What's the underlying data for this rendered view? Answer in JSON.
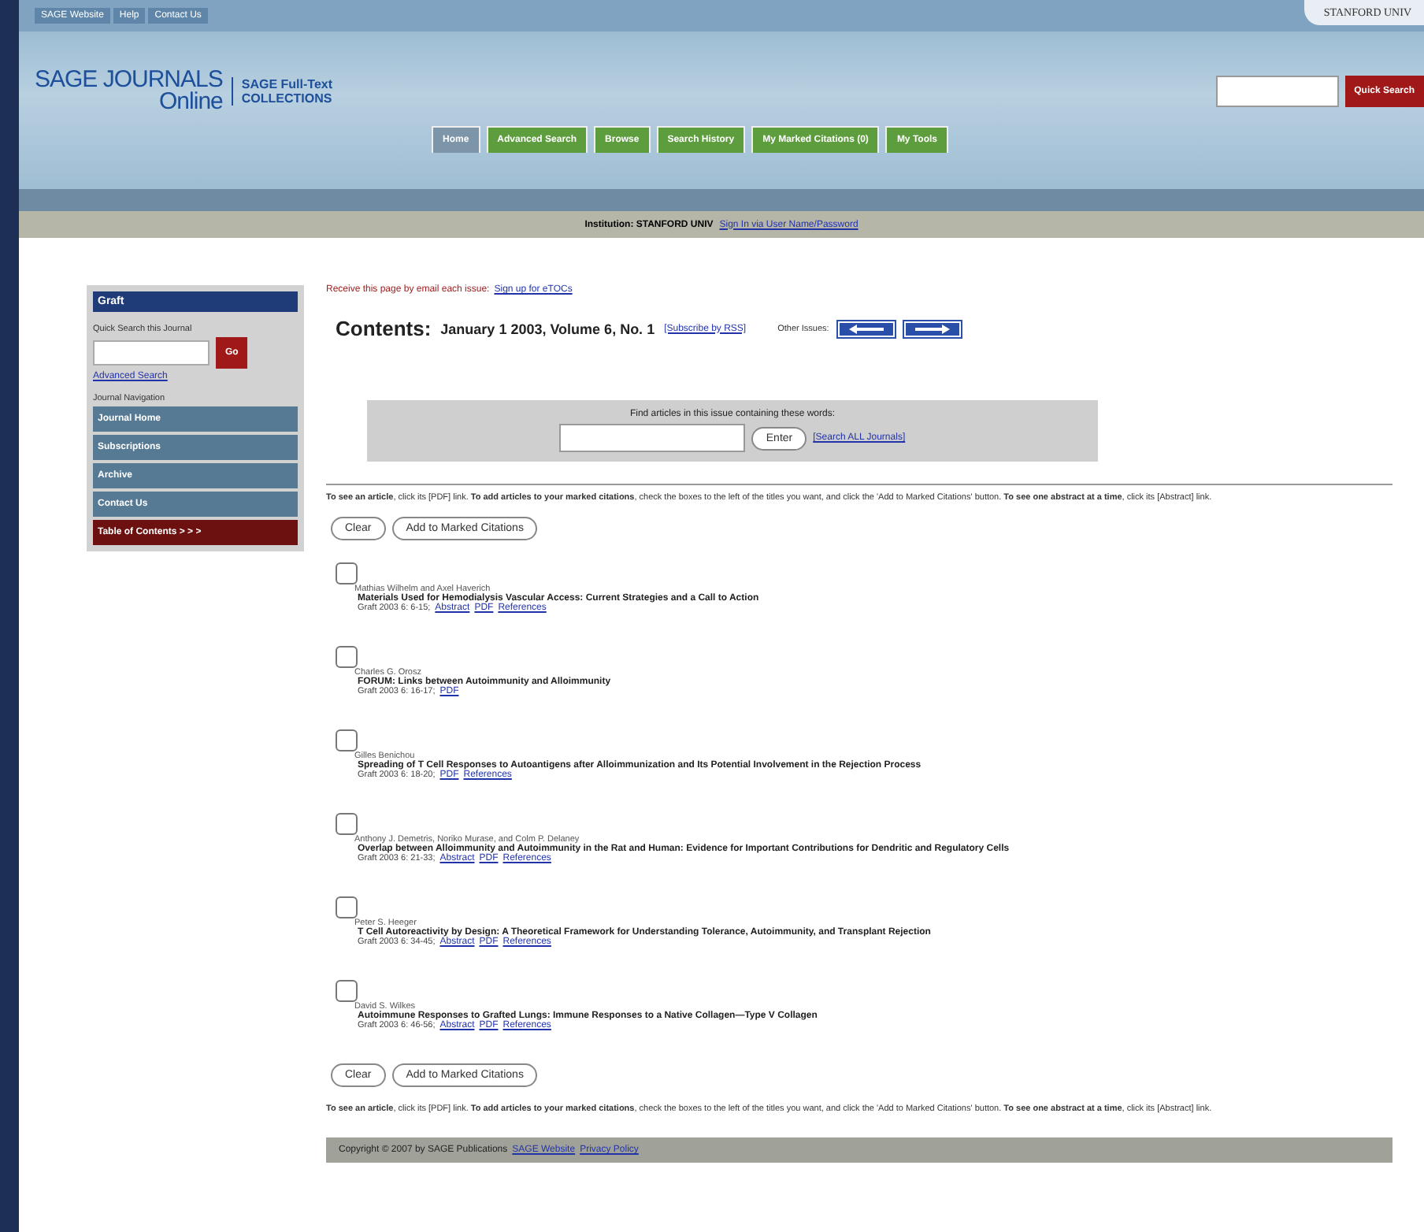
{
  "top_links": [
    "SAGE Website",
    "Help",
    "Contact Us"
  ],
  "institution_corner": "STANFORD UNIV",
  "logo": {
    "brand": "SAGE JOURNALS",
    "sub": "Online",
    "partner": "SAGE Full-Text",
    "partner_sub": "COLLECTIONS"
  },
  "quick_search": {
    "button": "Quick Search"
  },
  "tabs": [
    {
      "label": "Home",
      "selected": true
    },
    {
      "label": "Advanced Search",
      "selected": false
    },
    {
      "label": "Browse",
      "selected": false
    },
    {
      "label": "Search History",
      "selected": false
    },
    {
      "label": "My Marked Citations (0)",
      "selected": false
    },
    {
      "label": "My Tools",
      "selected": false
    }
  ],
  "institution": {
    "text": "Institution: STANFORD UNIV",
    "link": "Sign In via User Name/Password"
  },
  "sidebar": {
    "journal": "Graft",
    "search_label": "Quick Search this Journal",
    "go": "Go",
    "advanced": "Advanced Search",
    "nav_label": "Journal Navigation",
    "items": [
      {
        "label": "Journal Home",
        "selected": false
      },
      {
        "label": "Subscriptions",
        "selected": false
      },
      {
        "label": "Archive",
        "selected": false
      },
      {
        "label": "Contact Us",
        "selected": false
      },
      {
        "label": "Table of Contents > > >",
        "selected": true
      }
    ]
  },
  "email_notice": {
    "text": "Receive this page by email each issue:",
    "link": "Sign up for eTOCs"
  },
  "contents": {
    "heading": "Contents:",
    "issue": "January 1 2003, Volume 6, No. 1",
    "rss": "[Subscribe by RSS]",
    "other": "Other Issues:"
  },
  "find": {
    "label": "Find articles in this issue containing these words:",
    "button": "Enter",
    "link": "[Search ALL Journals]"
  },
  "instructions": [
    "**To see an article**, click its [PDF] link. **To add articles to your marked citations**, check the boxes to the left of the titles you want, and click the 'Add to Marked Citations' button. **To see one abstract at a time**, click its [Abstract] link.",
    "**To see an article**, click its [PDF] link. **To add articles to your marked citations**, check the boxes to the left of the titles you want, and click the 'Add to Marked Citations' button. **To see one abstract at a time**, click its [Abstract] link."
  ],
  "actions": [
    {
      "clear": "Clear",
      "add": "Add to Marked Citations"
    },
    {
      "clear": "Clear",
      "add": "Add to Marked Citations"
    }
  ],
  "articles": [
    {
      "checked": false,
      "authors": "Mathias Wilhelm and Axel Haverich",
      "title": "Materials Used for Hemodialysis Vascular Access: Current Strategies and a Call to Action",
      "citation": "Graft 2003 6: 6-15;",
      "links": [
        "Abstract",
        "PDF",
        "References"
      ]
    },
    {
      "checked": false,
      "authors": "Charles G. Orosz",
      "title": "FORUM: Links between Autoimmunity and Alloimmunity",
      "citation": "Graft 2003 6: 16-17;",
      "links": [
        "PDF"
      ]
    },
    {
      "checked": false,
      "authors": "Gilles Benichou",
      "title": "Spreading of T Cell Responses to Autoantigens after Alloimmunization and Its Potential Involvement in the Rejection Process",
      "citation": "Graft 2003 6: 18-20;",
      "links": [
        "PDF",
        "References"
      ]
    },
    {
      "checked": false,
      "authors": "Anthony J. Demetris, Noriko Murase, and Colm P. Delaney",
      "title": "Overlap between Alloimmunity and Autoimmunity in the Rat and Human: Evidence for Important Contributions for Dendritic and Regulatory Cells",
      "citation": "Graft 2003 6: 21-33;",
      "links": [
        "Abstract",
        "PDF",
        "References"
      ]
    },
    {
      "checked": false,
      "authors": "Peter S. Heeger",
      "title": "T Cell Autoreactivity by Design: A Theoretical Framework for Understanding Tolerance, Autoimmunity, and Transplant Rejection",
      "citation": "Graft 2003 6: 34-45;",
      "links": [
        "Abstract",
        "PDF",
        "References"
      ]
    },
    {
      "checked": false,
      "authors": "David S. Wilkes",
      "title": "Autoimmune Responses to Grafted Lungs: Immune Responses to a Native Collagen—Type V Collagen",
      "citation": "Graft 2003 6: 46-56;",
      "links": [
        "Abstract",
        "PDF",
        "References"
      ]
    }
  ],
  "footer": {
    "text": "Copyright © 2007 by SAGE Publications",
    "links": [
      "SAGE Website",
      "Privacy Policy"
    ]
  }
}
